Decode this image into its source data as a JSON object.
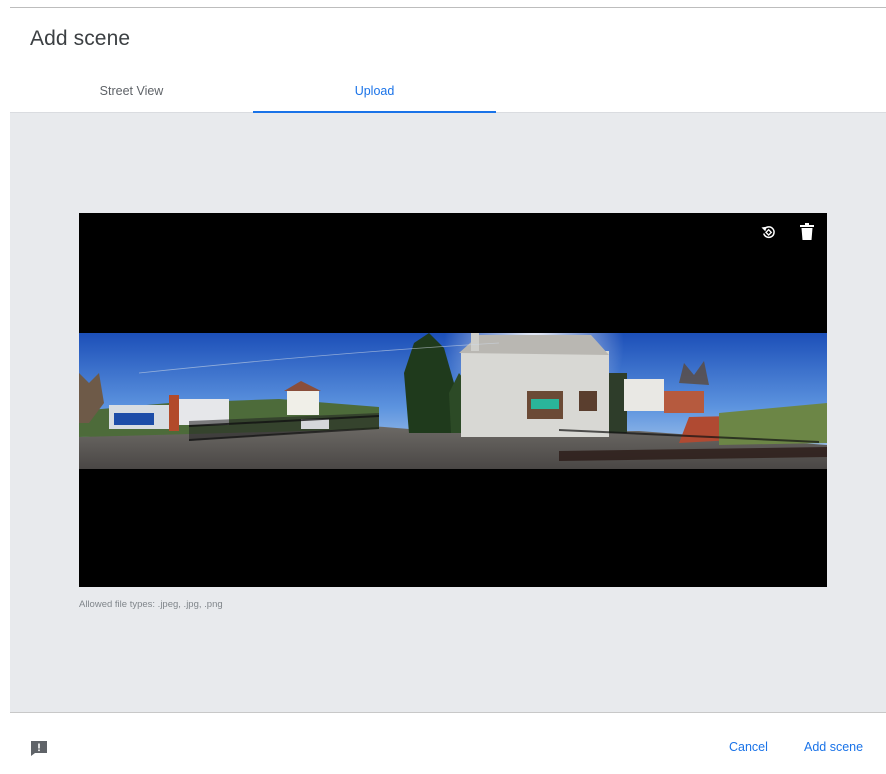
{
  "dialog": {
    "title": "Add scene"
  },
  "tabs": [
    {
      "label": "Street View",
      "selected": false
    },
    {
      "label": "Upload",
      "selected": true
    }
  ],
  "upload": {
    "allowed_types_text": "Allowed file types: .jpeg, .jpg, .png",
    "icons": [
      "rotate-icon",
      "delete-icon"
    ]
  },
  "footer": {
    "feedback_icon": "feedback-icon",
    "cancel_label": "Cancel",
    "add_label": "Add scene"
  },
  "colors": {
    "accent": "#1a73e8",
    "panel_background": "#e8eaed",
    "image_letterbox": "#000000"
  }
}
